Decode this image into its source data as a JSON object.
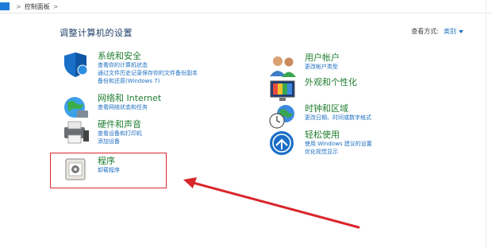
{
  "breadcrumb": {
    "current": "控制面板",
    "separator": ">"
  },
  "header": {
    "title": "调整计算机的设置",
    "view_by_label": "查看方式:",
    "view_by_value": "类别"
  },
  "categories": [
    {
      "title": "系统和安全",
      "icon": "shield-icon",
      "links": [
        "查看你的计算机状态",
        "通过文件历史记录保存你的文件备份副本",
        "备份和还原(Windows 7)"
      ]
    },
    {
      "title": "网络和 Internet",
      "icon": "network-globe-icon",
      "links": [
        "查看网络状态和任务"
      ]
    },
    {
      "title": "硬件和声音",
      "icon": "printer-speaker-icon",
      "links": [
        "查看设备和打印机",
        "添加设备"
      ]
    },
    {
      "title": "程序",
      "icon": "programs-icon",
      "links": [
        "卸载程序"
      ]
    },
    {
      "title": "用户帐户",
      "icon": "users-icon",
      "links": [
        "更改帐户类型"
      ]
    },
    {
      "title": "外观和个性化",
      "icon": "monitor-palette-icon",
      "links": []
    },
    {
      "title": "时钟和区域",
      "icon": "clock-globe-icon",
      "links": [
        "更改日期、时间或数字格式"
      ]
    },
    {
      "title": "轻松使用",
      "icon": "ease-of-access-icon",
      "links": [
        "使用 Windows 建议的设置",
        "优化视觉显示"
      ]
    }
  ],
  "annotation": {
    "highlight_color": "#d9262b"
  }
}
